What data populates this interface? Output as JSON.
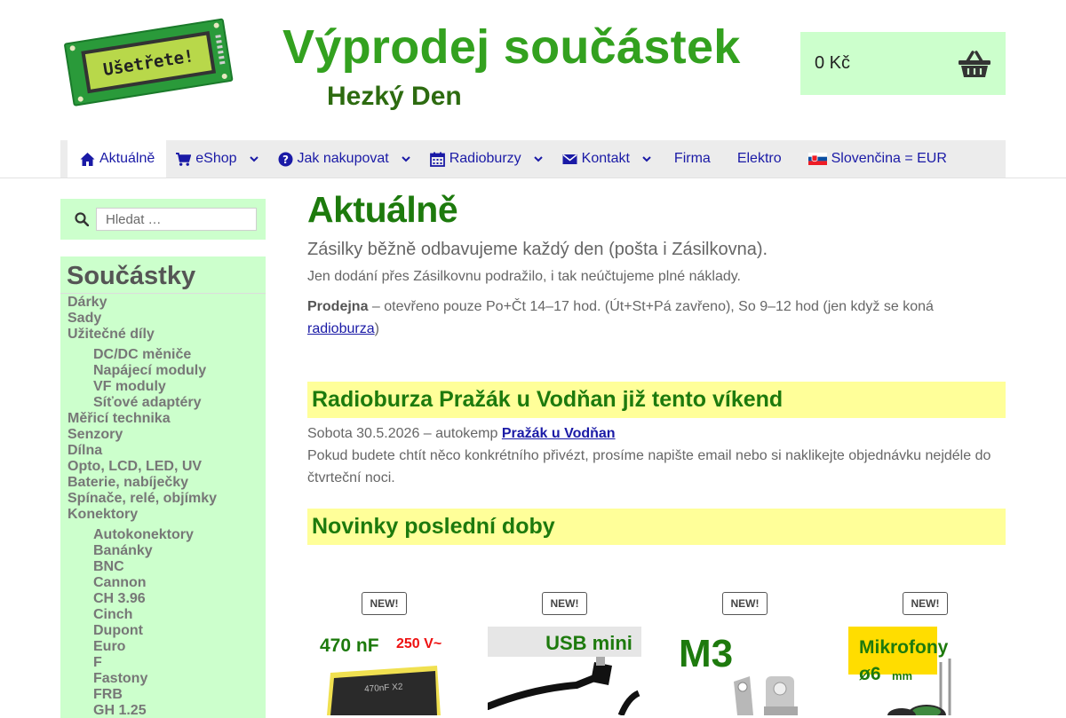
{
  "logo": {
    "text": "Ušetřete!"
  },
  "site": {
    "title": "Výprodej součástek",
    "tagline": "Hezký Den"
  },
  "cart": {
    "amount": "0 Kč"
  },
  "nav": {
    "items": [
      {
        "label": "Aktuálně"
      },
      {
        "label": "eShop"
      },
      {
        "label": "Jak nakupovat"
      },
      {
        "label": "Radioburzy"
      },
      {
        "label": "Kontakt"
      },
      {
        "label": "Firma"
      },
      {
        "label": "Elektro"
      },
      {
        "label": "Slovenčina = EUR"
      }
    ]
  },
  "search": {
    "placeholder": "Hledat …"
  },
  "categories": {
    "title": "Součástky",
    "items": [
      "Dárky",
      "Sady",
      "Užitečné díly",
      "DC/DC měniče",
      "Napájecí moduly",
      "VF moduly",
      "Síťové adaptéry",
      "Měřicí technika",
      "Senzory",
      "Dílna",
      "Opto, LCD, LED, UV",
      "Baterie, nabíječky",
      "Spínače, relé, objímky",
      "Konektory",
      "Autokonektory",
      "Banánky",
      "BNC",
      "Cannon",
      "CH 3.96",
      "Cinch",
      "Dupont",
      "Euro",
      "F",
      "Fastony",
      "FRB",
      "GH 1.25"
    ]
  },
  "main": {
    "title": "Aktuálně",
    "lead": "Zásilky běžně odbavujeme každý den (pošta i Zásilkovna).",
    "p1": "Jen dodání přes Zásilkovnu podražilo, i tak neúčtujeme plné náklady.",
    "p2_bold": "Prodejna",
    "p2_text": " – otevřeno pouze Po+Čt  14–17 hod. (Út+St+Pá zavřeno), So 9–12 hod (jen když se koná ",
    "p2_link": "radioburza",
    "p2_end": ")",
    "sec1_title": "Radioburza Pražák u Vodňan již tento víkend",
    "sec1_line_text": "Sobota 30.5.2026 – autokemp ",
    "sec1_line_link": "Pražák u Vodňan",
    "sec1_p": "Pokud budete chtít něco konkrétního přivézt, prosíme napište email nebo si naklikejte objednávku nejdéle do čtvrteční noci.",
    "sec2_title": "Novinky poslední doby"
  },
  "products": [
    {
      "badge": "NEW!",
      "l1": "470 nF",
      "l2": "250 V~",
      "l3": "470nF X2"
    },
    {
      "badge": "NEW!",
      "l1": "USB mini"
    },
    {
      "badge": "NEW!",
      "l1": "M3"
    },
    {
      "badge": "NEW!",
      "l1": "Mikrofony",
      "l2": "ø6",
      "l3": "mm"
    }
  ],
  "colors": {
    "green_title": "#33a11f",
    "nav_link": "#1a1aa6",
    "sidebar_bg": "#ccffcc",
    "section_bg": "#ffff99"
  }
}
